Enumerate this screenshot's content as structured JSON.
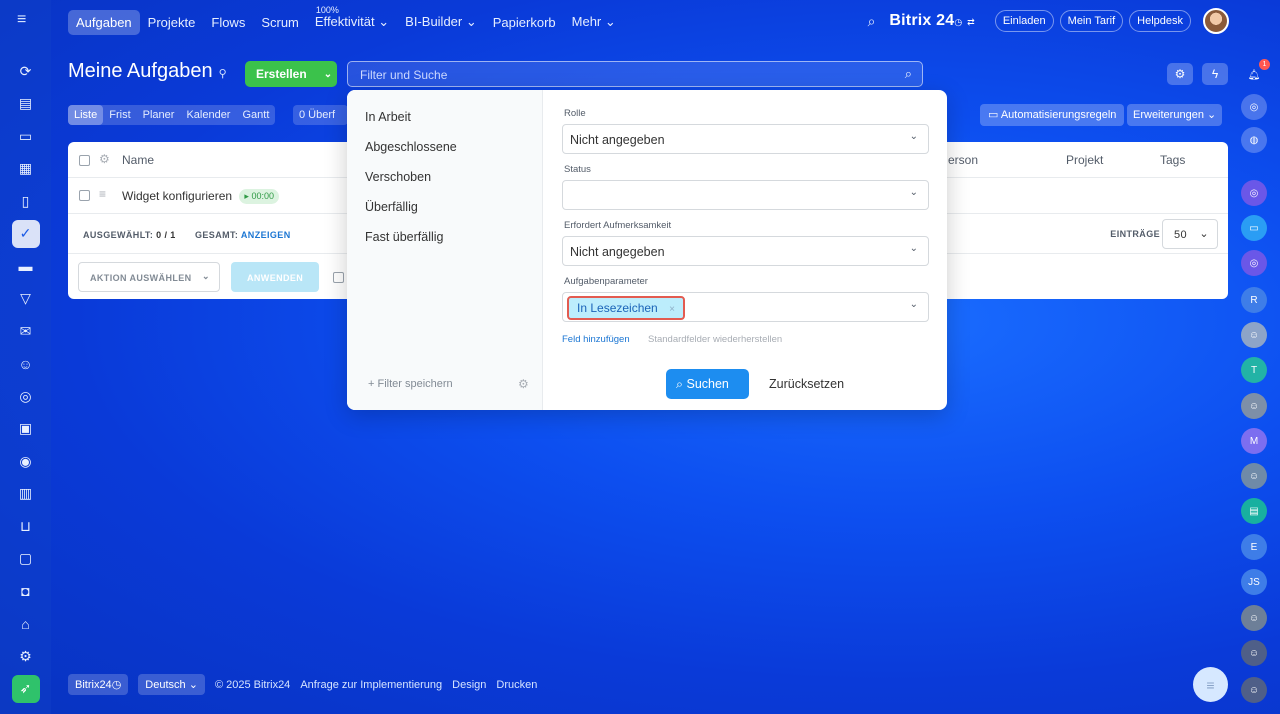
{
  "topnav": {
    "items": [
      "Aufgaben",
      "Projekte",
      "Flows",
      "Scrum",
      "Effektivität",
      "BI-Builder",
      "Papierkorb",
      "Mehr"
    ],
    "effektivitaet_percent": "100%",
    "brand": "Bitrix 24",
    "invite": "Einladen",
    "tariff": "Mein Tarif",
    "helpdesk": "Helpdesk"
  },
  "page": {
    "title": "Meine Aufgaben",
    "create_button": "Erstellen",
    "search_placeholder": "Filter und Suche",
    "view_tabs": [
      "Liste",
      "Frist",
      "Planer",
      "Kalender",
      "Gantt"
    ],
    "counter_chip": "0 Überf",
    "automation_button": "Automatisierungsregeln",
    "extensions_button": "Erweiterungen"
  },
  "grid": {
    "col_name": "Name",
    "col_person": "erson",
    "col_project": "Projekt",
    "col_tags": "Tags",
    "row_title": "Widget konfigurieren",
    "row_timer": "00:00",
    "selected_label": "AUSGEWÄHLT:",
    "selected_value": "0 / 1",
    "total_label": "GESAMT:",
    "total_link": "ANZEIGEN",
    "entries_label": "EINTRÄGE",
    "entries_value": "50",
    "action_select": "AKTION AUSWÄHLEN",
    "apply_button": "ANWENDEN"
  },
  "filter_popup": {
    "presets": [
      "In Arbeit",
      "Abgeschlossene",
      "Verschoben",
      "Überfällig",
      "Fast überfällig"
    ],
    "save_filter": "+ Filter speichern",
    "fields": {
      "role_label": "Rolle",
      "role_value": "Nicht angegeben",
      "status_label": "Status",
      "status_value": "",
      "attention_label": "Erfordert Aufmerksamkeit",
      "attention_value": "Nicht angegeben",
      "params_label": "Aufgabenparameter",
      "params_tag": "In Lesezeichen"
    },
    "add_field": "Feld hinzufügen",
    "restore_fields": "Standardfelder wiederherstellen",
    "search_button": "Suchen",
    "reset_button": "Zurücksetzen"
  },
  "right_sidebar": {
    "notification_count": "1",
    "initials": [
      "R",
      "T",
      "M",
      "E",
      "JS"
    ]
  },
  "footer": {
    "brand": "Bitrix24",
    "language": "Deutsch",
    "copyright": "© 2025 Bitrix24",
    "impl_request": "Anfrage zur Implementierung",
    "design": "Design",
    "print": "Drucken"
  },
  "colors": {
    "create_green": "#3bc24b",
    "search_blue": "#1d8df0",
    "highlight_red": "#e35b50",
    "tag_bg": "#bcedfc"
  }
}
